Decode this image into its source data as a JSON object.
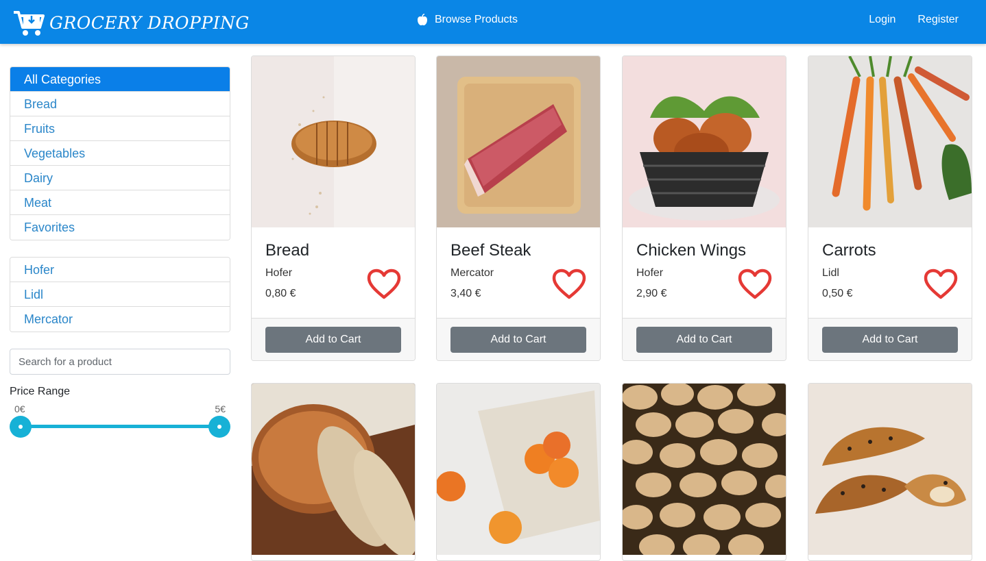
{
  "navbar": {
    "brand": "GROCERY DROPPING",
    "browse_label": "Browse Products",
    "login_label": "Login",
    "register_label": "Register",
    "color": "#0a86e6"
  },
  "sidebar": {
    "categories": [
      "All Categories",
      "Bread",
      "Fruits",
      "Vegetables",
      "Dairy",
      "Meat",
      "Favorites"
    ],
    "active_category": "All Categories",
    "stores": [
      "Hofer",
      "Lidl",
      "Mercator"
    ],
    "search_placeholder": "Search for a product",
    "price_range_label": "Price Range",
    "price_min": "0€",
    "price_max": "5€"
  },
  "products": [
    {
      "name": "Bread",
      "store": "Hofer",
      "price": "0,80 €",
      "button": "Add to Cart",
      "image_icon": "bread-image"
    },
    {
      "name": "Beef Steak",
      "store": "Mercator",
      "price": "3,40 €",
      "button": "Add to Cart",
      "image_icon": "steak-image"
    },
    {
      "name": "Chicken Wings",
      "store": "Hofer",
      "price": "2,90 €",
      "button": "Add to Cart",
      "image_icon": "chicken-image"
    },
    {
      "name": "Carrots",
      "store": "Lidl",
      "price": "0,50 €",
      "button": "Add to Cart",
      "image_icon": "carrots-image"
    }
  ],
  "second_row_images": [
    "bread-loaf-image",
    "apricots-image",
    "potatoes-image",
    "croissant-image"
  ],
  "colors": {
    "accent": "#0a86e6",
    "heart": "#e53935",
    "button": "#6c757d",
    "slider": "#17b1d6"
  }
}
